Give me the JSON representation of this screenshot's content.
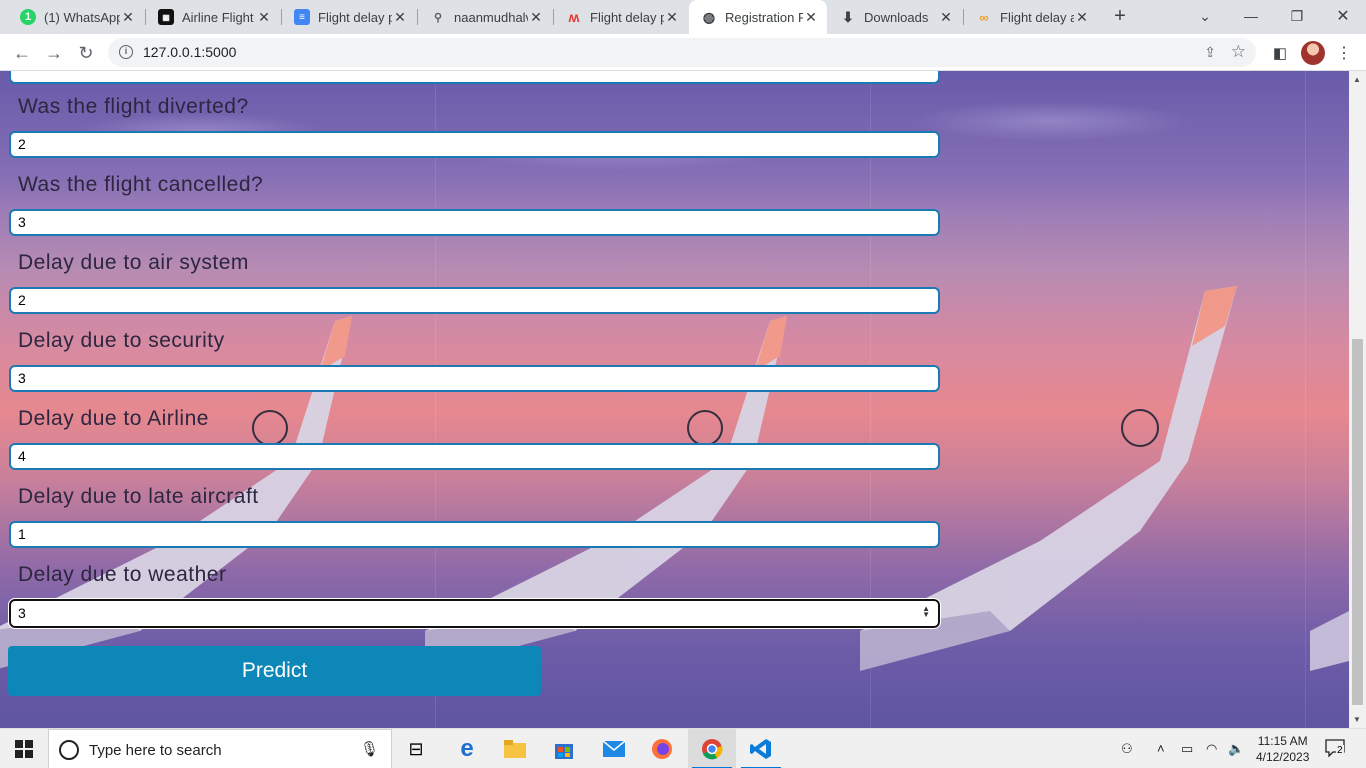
{
  "browser": {
    "tabs": [
      {
        "title": "(1) WhatsApp",
        "icon": "whatsapp-icon"
      },
      {
        "title": "Airline Flight",
        "icon": "ibm-icon"
      },
      {
        "title": "Flight delay p",
        "icon": "docs-icon"
      },
      {
        "title": "naanmudhalv",
        "icon": "link-icon"
      },
      {
        "title": "Flight delay p",
        "icon": "m-icon"
      },
      {
        "title": "Registration F",
        "icon": "globe-icon",
        "active": true
      },
      {
        "title": "Downloads",
        "icon": "download-icon"
      },
      {
        "title": "Flight delay a",
        "icon": "fire-icon"
      }
    ],
    "url": "127.0.0.1:5000"
  },
  "form": {
    "fields": [
      {
        "label": "Was the flight diverted?",
        "value": "2"
      },
      {
        "label": "Was the flight cancelled?",
        "value": "3"
      },
      {
        "label": "Delay due to air system",
        "value": "2"
      },
      {
        "label": "Delay due to security",
        "value": "3"
      },
      {
        "label": "Delay due to Airline",
        "value": "4"
      },
      {
        "label": "Delay due to late aircraft",
        "value": "1"
      },
      {
        "label": "Delay due to weather",
        "value": "3"
      }
    ],
    "submit_label": "Predict"
  },
  "taskbar": {
    "search_placeholder": "Type here to search",
    "time": "11:15 AM",
    "date": "4/12/2023",
    "notifications": "2"
  },
  "colors": {
    "accent": "#0d86b8",
    "input_border": "#1b7ab4"
  }
}
